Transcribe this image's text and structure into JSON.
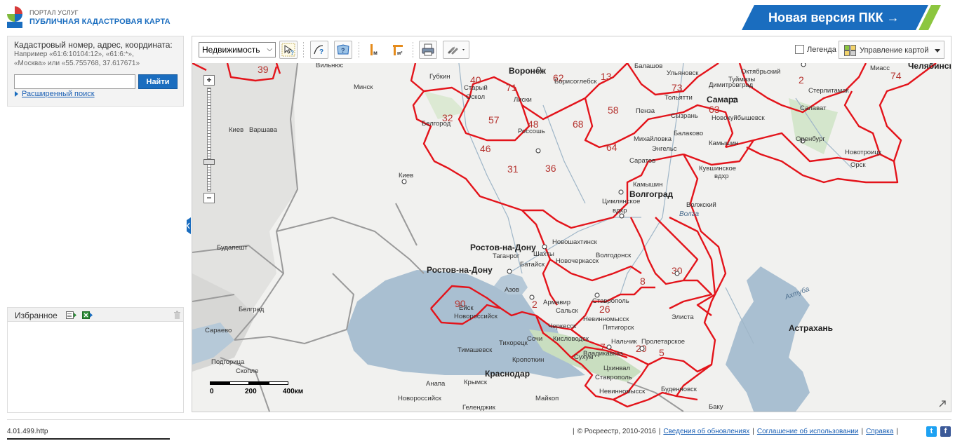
{
  "header": {
    "logo_line1": "ПОРТАЛ УСЛУГ",
    "logo_line2": "ПУБЛИЧНАЯ КАДАСТРОВАЯ КАРТА",
    "promo": "Новая версия ПКК →",
    "colors": {
      "brand_blue": "#1a6dbf",
      "promo_green": "#8cc63f"
    }
  },
  "search": {
    "label": "Кадастровый номер, адрес, координата:",
    "hint_line1": "Например «61:6:10104:12», «61:6:*»,",
    "hint_line2": "«Москва» или «55.755768, 37.617671»",
    "input_value": "",
    "button": "Найти",
    "advanced": "Расширенный поиск"
  },
  "favorites": {
    "title": "Избранное"
  },
  "toolbar": {
    "layer_select": "Недвижимость",
    "legend_label": "Легенда",
    "legend_checked": false,
    "map_control": "Управление картой"
  },
  "map": {
    "scale": {
      "left": "0",
      "mid": "200",
      "right": "400км"
    },
    "region_numbers": [
      "39",
      "40",
      "62",
      "13",
      "73",
      "2",
      "74",
      "32",
      "57",
      "71",
      "48",
      "68",
      "58",
      "63",
      "46",
      "31",
      "36",
      "64",
      "30",
      "8",
      "90",
      "2",
      "26",
      "7",
      "20",
      "5"
    ],
    "cities_large": [
      "Воронеж",
      "Самара",
      "Волгоград",
      "Ростов-на-Дону",
      "Ростов-на-Дону",
      "Краснодар",
      "Астрахань",
      "Челябинск"
    ],
    "cities_small": [
      "Вильнюс",
      "Минск",
      "Киев",
      "Варшава",
      "Будапешт",
      "Белград",
      "Сараево",
      "Подгорица",
      "Скопле",
      "Губкин",
      "Старый Оскол",
      "Лиски",
      "Борисоглебск",
      "Балашов",
      "Ульяновск",
      "Октябрьский",
      "Туймазы",
      "Миасс",
      "Стерлитамак",
      "Салават",
      "Тольятти",
      "Димитровград",
      "Пенза",
      "Сызрань",
      "Новокуйбышевск",
      "Белгород",
      "Россошь",
      "Балаково",
      "Михайловка",
      "Энгельс",
      "Саратов",
      "Камышин",
      "Оренбург",
      "Новотроицк",
      "Орск",
      "Кувшинское вдхр",
      "Волжский",
      "Цимлянское вдхр",
      "Новошахтинск",
      "Шахты",
      "Волгодонск",
      "Таганрог",
      "Батайск",
      "Новочеркасск",
      "Азов",
      "Ейск",
      "Новороссийск",
      "Армавир",
      "Сальск",
      "Ставрополь",
      "Невинномысск",
      "Пятигорск",
      "Черкесск",
      "Кисловодск",
      "Нальчик",
      "Владикавказ",
      "Сочи",
      "Тихорецк",
      "Тимашевск",
      "Кропоткин",
      "Сухум",
      "Цхинвал",
      "Элиста",
      "Пролетарское",
      "Буденновск",
      "Баку",
      "Анапа",
      "Крымск",
      "Новороссийск",
      "Геленджик",
      "Майкоп",
      "Ахтуба",
      "Невинномысск"
    ],
    "regions_ghost": [
      "Ахтуба"
    ]
  },
  "footer": {
    "version": "4.01.499.http",
    "copyright": "© Росреестр, 2010-2016",
    "link1": "Сведения об обновлениях",
    "link2": "Соглашение об использовании",
    "link3": "Справка"
  }
}
